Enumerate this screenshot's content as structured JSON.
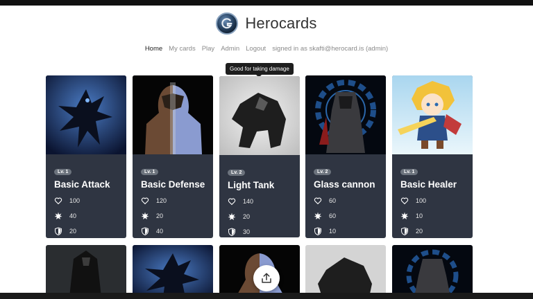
{
  "brand": {
    "name": "Herocards",
    "logo_icon": "herocards-logo-icon"
  },
  "nav": {
    "home": "Home",
    "my_cards": "My cards",
    "play": "Play",
    "admin": "Admin",
    "logout": "Logout",
    "signed_in": "signed in as skafti@herocard.is (admin)"
  },
  "tooltip": "Good for taking damage",
  "cards": [
    {
      "level": "Lv. 1",
      "name": "Basic Attack",
      "health": "100",
      "attack": "40",
      "defense": "20",
      "art": "blue-demon"
    },
    {
      "level": "Lv. 1",
      "name": "Basic Defense",
      "health": "120",
      "attack": "20",
      "defense": "40",
      "art": "split-warrior"
    },
    {
      "level": "Lv. 2",
      "name": "Light Tank",
      "health": "140",
      "attack": "20",
      "defense": "30",
      "art": "grey-mech"
    },
    {
      "level": "Lv. 2",
      "name": "Glass cannon",
      "health": "60",
      "attack": "60",
      "defense": "10",
      "art": "gear-knight"
    },
    {
      "level": "Lv. 1",
      "name": "Basic Healer",
      "health": "100",
      "attack": "10",
      "defense": "20",
      "art": "chibi-hero"
    }
  ],
  "second_row_art": [
    "dark-rogue",
    "blue-demon",
    "split-warrior",
    "grey-mech",
    "gear-knight"
  ],
  "icons": {
    "health": "heart-icon",
    "attack": "burst-icon",
    "defense": "shield-icon",
    "upload": "upload-icon"
  },
  "colors": {
    "card_bg": "#2f3542",
    "level_badge": "#6c737d",
    "nav_active": "#222222",
    "nav": "#8a8a8a"
  }
}
